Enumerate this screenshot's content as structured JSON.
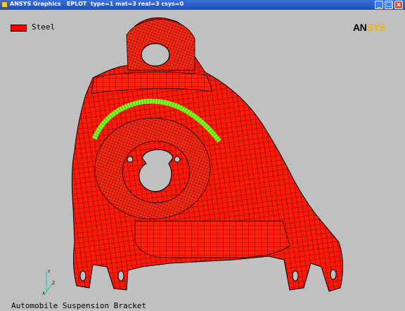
{
  "window": {
    "title": "ANSYS Graphics   EPLOT  type=1 mat=3 real=3 csys=0",
    "controls": {
      "minimize": "_",
      "maximize": "□",
      "close": "x"
    }
  },
  "legend": {
    "label": "Steel",
    "color": "#ff0000"
  },
  "logo": {
    "part1": "AN",
    "part2": "SYS"
  },
  "caption": "Automobile Suspension Bracket",
  "triad": {
    "y": "Y",
    "z": "Z",
    "x": "X"
  },
  "colors": {
    "mesh_fill": "#ff1a0a",
    "mesh_line": "#000000",
    "highlight": "#7cff1e",
    "background": "#c0c0c0"
  }
}
